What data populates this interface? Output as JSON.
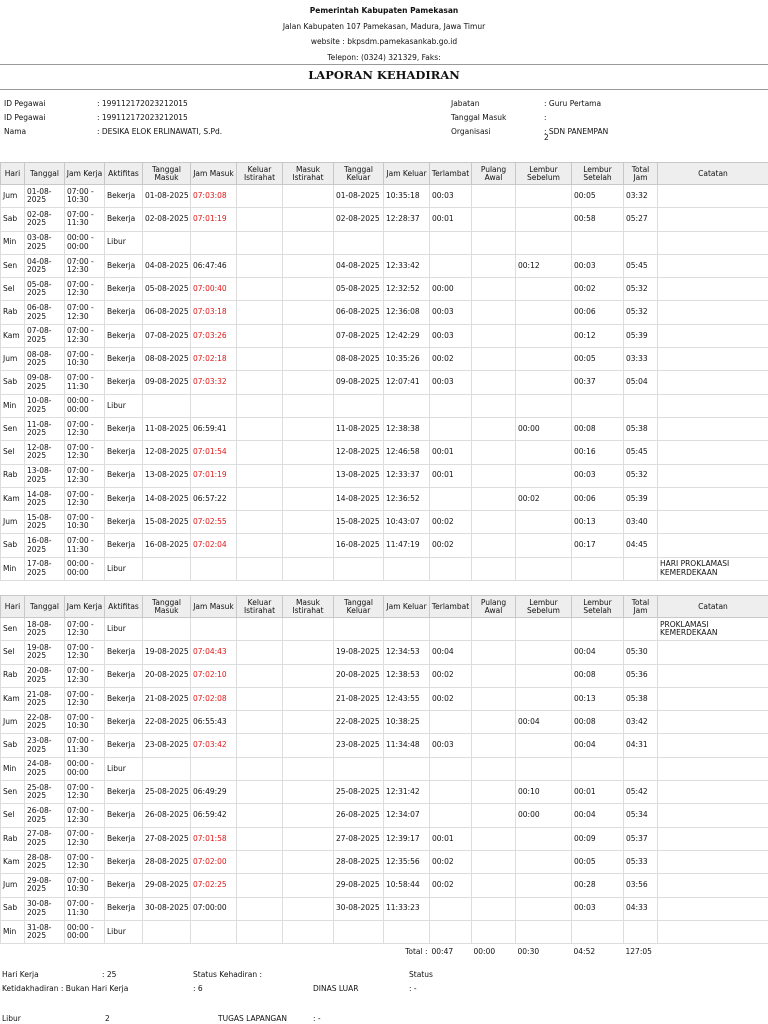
{
  "header": {
    "agency": "Pemerintah Kabupaten Pamekasan",
    "address": "Jalan Kabupaten 107 Pamekasan, Madura, Jawa Timur",
    "website": "website : bkpsdm.pamekasankab.go.id",
    "phone": "Telepon: (0324) 321329, Faks:"
  },
  "title": "LAPORAN KEHADIRAN",
  "employee": {
    "left": [
      {
        "label": "ID Pegawai",
        "value": ": 199112172023212015"
      },
      {
        "label": "ID Pegawai",
        "value": ": 199112172023212015"
      },
      {
        "label": "Nama",
        "value": ": DESIKA ELOK ERLINAWATI, S.Pd."
      }
    ],
    "right": [
      {
        "label": "Jabatan",
        "value": ": Guru Pertama"
      },
      {
        "label": "Tanggal Masuk",
        "value": ":"
      },
      {
        "label": "Organisasi",
        "value": ": SDN PANEMPAN",
        "value2": "2"
      }
    ]
  },
  "columns": [
    "Hari",
    "Tanggal",
    "Jam Kerja",
    "Aktifitas",
    "Tanggal Masuk",
    "Jam Masuk",
    "Keluar Istirahat",
    "Masuk Istirahat",
    "Tanggal Keluar",
    "Jam Keluar",
    "Terlambat",
    "Pulang Awal",
    "Lembur Sebelum",
    "Lembur Setelah",
    "Total Jam",
    "Catatan"
  ],
  "late_color": "#e01818",
  "table1": [
    {
      "hari": "Jum",
      "tgl": "01-08-2025",
      "jk": "07:00 - 10:30",
      "akt": "Bekerja",
      "tm": "01-08-2025",
      "jm": "07:03:08",
      "late": true,
      "tk": "01-08-2025",
      "jkel": "10:35:18",
      "tl": "00:03",
      "pa": "",
      "ls": "",
      "lst": "00:05",
      "tj": "03:32",
      "cat": ""
    },
    {
      "hari": "Sab",
      "tgl": "02-08-2025",
      "jk": "07:00 - 11:30",
      "akt": "Bekerja",
      "tm": "02-08-2025",
      "jm": "07:01:19",
      "late": true,
      "tk": "02-08-2025",
      "jkel": "12:28:37",
      "tl": "00:01",
      "pa": "",
      "ls": "",
      "lst": "00:58",
      "tj": "05:27",
      "cat": ""
    },
    {
      "hari": "Min",
      "tgl": "03-08-2025",
      "jk": "00:00 - 00:00",
      "akt": "Libur",
      "tm": "",
      "jm": "",
      "late": false,
      "tk": "",
      "jkel": "",
      "tl": "",
      "pa": "",
      "ls": "",
      "lst": "",
      "tj": "",
      "cat": ""
    },
    {
      "hari": "Sen",
      "tgl": "04-08-2025",
      "jk": "07:00 - 12:30",
      "akt": "Bekerja",
      "tm": "04-08-2025",
      "jm": "06:47:46",
      "late": false,
      "tk": "04-08-2025",
      "jkel": "12:33:42",
      "tl": "",
      "pa": "",
      "ls": "00:12",
      "lst": "00:03",
      "tj": "05:45",
      "cat": ""
    },
    {
      "hari": "Sel",
      "tgl": "05-08-2025",
      "jk": "07:00 - 12:30",
      "akt": "Bekerja",
      "tm": "05-08-2025",
      "jm": "07:00:40",
      "late": true,
      "tk": "05-08-2025",
      "jkel": "12:32:52",
      "tl": "00:00",
      "pa": "",
      "ls": "",
      "lst": "00:02",
      "tj": "05:32",
      "cat": ""
    },
    {
      "hari": "Rab",
      "tgl": "06-08-2025",
      "jk": "07:00 - 12:30",
      "akt": "Bekerja",
      "tm": "06-08-2025",
      "jm": "07:03:18",
      "late": true,
      "tk": "06-08-2025",
      "jkel": "12:36:08",
      "tl": "00:03",
      "pa": "",
      "ls": "",
      "lst": "00:06",
      "tj": "05:32",
      "cat": ""
    },
    {
      "hari": "Kam",
      "tgl": "07-08-2025",
      "jk": "07:00 - 12:30",
      "akt": "Bekerja",
      "tm": "07-08-2025",
      "jm": "07:03:26",
      "late": true,
      "tk": "07-08-2025",
      "jkel": "12:42:29",
      "tl": "00:03",
      "pa": "",
      "ls": "",
      "lst": "00:12",
      "tj": "05:39",
      "cat": ""
    },
    {
      "hari": "Jum",
      "tgl": "08-08-2025",
      "jk": "07:00 - 10:30",
      "akt": "Bekerja",
      "tm": "08-08-2025",
      "jm": "07:02:18",
      "late": true,
      "tk": "08-08-2025",
      "jkel": "10:35:26",
      "tl": "00:02",
      "pa": "",
      "ls": "",
      "lst": "00:05",
      "tj": "03:33",
      "cat": ""
    },
    {
      "hari": "Sab",
      "tgl": "09-08-2025",
      "jk": "07:00 - 11:30",
      "akt": "Bekerja",
      "tm": "09-08-2025",
      "jm": "07:03:32",
      "late": true,
      "tk": "09-08-2025",
      "jkel": "12:07:41",
      "tl": "00:03",
      "pa": "",
      "ls": "",
      "lst": "00:37",
      "tj": "05:04",
      "cat": ""
    },
    {
      "hari": "Min",
      "tgl": "10-08-2025",
      "jk": "00:00 - 00:00",
      "akt": "Libur",
      "tm": "",
      "jm": "",
      "late": false,
      "tk": "",
      "jkel": "",
      "tl": "",
      "pa": "",
      "ls": "",
      "lst": "",
      "tj": "",
      "cat": ""
    },
    {
      "hari": "Sen",
      "tgl": "11-08-2025",
      "jk": "07:00 - 12:30",
      "akt": "Bekerja",
      "tm": "11-08-2025",
      "jm": "06:59:41",
      "late": false,
      "tk": "11-08-2025",
      "jkel": "12:38:38",
      "tl": "",
      "pa": "",
      "ls": "00:00",
      "lst": "00:08",
      "tj": "05:38",
      "cat": ""
    },
    {
      "hari": "Sel",
      "tgl": "12-08-2025",
      "jk": "07:00 - 12:30",
      "akt": "Bekerja",
      "tm": "12-08-2025",
      "jm": "07:01:54",
      "late": true,
      "tk": "12-08-2025",
      "jkel": "12:46:58",
      "tl": "00:01",
      "pa": "",
      "ls": "",
      "lst": "00:16",
      "tj": "05:45",
      "cat": ""
    },
    {
      "hari": "Rab",
      "tgl": "13-08-2025",
      "jk": "07:00 - 12:30",
      "akt": "Bekerja",
      "tm": "13-08-2025",
      "jm": "07:01:19",
      "late": true,
      "tk": "13-08-2025",
      "jkel": "12:33:37",
      "tl": "00:01",
      "pa": "",
      "ls": "",
      "lst": "00:03",
      "tj": "05:32",
      "cat": ""
    },
    {
      "hari": "Kam",
      "tgl": "14-08-2025",
      "jk": "07:00 - 12:30",
      "akt": "Bekerja",
      "tm": "14-08-2025",
      "jm": "06:57:22",
      "late": false,
      "tk": "14-08-2025",
      "jkel": "12:36:52",
      "tl": "",
      "pa": "",
      "ls": "00:02",
      "lst": "00:06",
      "tj": "05:39",
      "cat": ""
    },
    {
      "hari": "Jum",
      "tgl": "15-08-2025",
      "jk": "07:00 - 10:30",
      "akt": "Bekerja",
      "tm": "15-08-2025",
      "jm": "07:02:55",
      "late": true,
      "tk": "15-08-2025",
      "jkel": "10:43:07",
      "tl": "00:02",
      "pa": "",
      "ls": "",
      "lst": "00:13",
      "tj": "03:40",
      "cat": ""
    },
    {
      "hari": "Sab",
      "tgl": "16-08-2025",
      "jk": "07:00 - 11:30",
      "akt": "Bekerja",
      "tm": "16-08-2025",
      "jm": "07:02:04",
      "late": true,
      "tk": "16-08-2025",
      "jkel": "11:47:19",
      "tl": "00:02",
      "pa": "",
      "ls": "",
      "lst": "00:17",
      "tj": "04:45",
      "cat": ""
    },
    {
      "hari": "Min",
      "tgl": "17-08-2025",
      "jk": "00:00 - 00:00",
      "akt": "Libur",
      "tm": "",
      "jm": "",
      "late": false,
      "tk": "",
      "jkel": "",
      "tl": "",
      "pa": "",
      "ls": "",
      "lst": "",
      "tj": "",
      "cat": "HARI PROKLAMASI KEMERDEKAAN"
    }
  ],
  "table2": [
    {
      "hari": "Sen",
      "tgl": "18-08-2025",
      "jk": "07:00 - 12:30",
      "akt": "Libur",
      "tm": "",
      "jm": "",
      "late": false,
      "tk": "",
      "jkel": "",
      "tl": "",
      "pa": "",
      "ls": "",
      "lst": "",
      "tj": "",
      "cat": "PROKLAMASI KEMERDEKAAN"
    },
    {
      "hari": "Sel",
      "tgl": "19-08-2025",
      "jk": "07:00 - 12:30",
      "akt": "Bekerja",
      "tm": "19-08-2025",
      "jm": "07:04:43",
      "late": true,
      "tk": "19-08-2025",
      "jkel": "12:34:53",
      "tl": "00:04",
      "pa": "",
      "ls": "",
      "lst": "00:04",
      "tj": "05:30",
      "cat": ""
    },
    {
      "hari": "Rab",
      "tgl": "20-08-2025",
      "jk": "07:00 - 12:30",
      "akt": "Bekerja",
      "tm": "20-08-2025",
      "jm": "07:02:10",
      "late": true,
      "tk": "20-08-2025",
      "jkel": "12:38:53",
      "tl": "00:02",
      "pa": "",
      "ls": "",
      "lst": "00:08",
      "tj": "05:36",
      "cat": ""
    },
    {
      "hari": "Kam",
      "tgl": "21-08-2025",
      "jk": "07:00 - 12:30",
      "akt": "Bekerja",
      "tm": "21-08-2025",
      "jm": "07:02:08",
      "late": true,
      "tk": "21-08-2025",
      "jkel": "12:43:55",
      "tl": "00:02",
      "pa": "",
      "ls": "",
      "lst": "00:13",
      "tj": "05:38",
      "cat": ""
    },
    {
      "hari": "Jum",
      "tgl": "22-08-2025",
      "jk": "07:00 - 10:30",
      "akt": "Bekerja",
      "tm": "22-08-2025",
      "jm": "06:55:43",
      "late": false,
      "tk": "22-08-2025",
      "jkel": "10:38:25",
      "tl": "",
      "pa": "",
      "ls": "00:04",
      "lst": "00:08",
      "tj": "03:42",
      "cat": ""
    },
    {
      "hari": "Sab",
      "tgl": "23-08-2025",
      "jk": "07:00 - 11:30",
      "akt": "Bekerja",
      "tm": "23-08-2025",
      "jm": "07:03:42",
      "late": true,
      "tk": "23-08-2025",
      "jkel": "11:34:48",
      "tl": "00:03",
      "pa": "",
      "ls": "",
      "lst": "00:04",
      "tj": "04:31",
      "cat": ""
    },
    {
      "hari": "Min",
      "tgl": "24-08-2025",
      "jk": "00:00 - 00:00",
      "akt": "Libur",
      "tm": "",
      "jm": "",
      "late": false,
      "tk": "",
      "jkel": "",
      "tl": "",
      "pa": "",
      "ls": "",
      "lst": "",
      "tj": "",
      "cat": ""
    },
    {
      "hari": "Sen",
      "tgl": "25-08-2025",
      "jk": "07:00 - 12:30",
      "akt": "Bekerja",
      "tm": "25-08-2025",
      "jm": "06:49:29",
      "late": false,
      "tk": "25-08-2025",
      "jkel": "12:31:42",
      "tl": "",
      "pa": "",
      "ls": "00:10",
      "lst": "00:01",
      "tj": "05:42",
      "cat": ""
    },
    {
      "hari": "Sel",
      "tgl": "26-08-2025",
      "jk": "07:00 - 12:30",
      "akt": "Bekerja",
      "tm": "26-08-2025",
      "jm": "06:59:42",
      "late": false,
      "tk": "26-08-2025",
      "jkel": "12:34:07",
      "tl": "",
      "pa": "",
      "ls": "00:00",
      "lst": "00:04",
      "tj": "05:34",
      "cat": ""
    },
    {
      "hari": "Rab",
      "tgl": "27-08-2025",
      "jk": "07:00 - 12:30",
      "akt": "Bekerja",
      "tm": "27-08-2025",
      "jm": "07:01:58",
      "late": true,
      "tk": "27-08-2025",
      "jkel": "12:39:17",
      "tl": "00:01",
      "pa": "",
      "ls": "",
      "lst": "00:09",
      "tj": "05:37",
      "cat": ""
    },
    {
      "hari": "Kam",
      "tgl": "28-08-2025",
      "jk": "07:00 - 12:30",
      "akt": "Bekerja",
      "tm": "28-08-2025",
      "jm": "07:02:00",
      "late": true,
      "tk": "28-08-2025",
      "jkel": "12:35:56",
      "tl": "00:02",
      "pa": "",
      "ls": "",
      "lst": "00:05",
      "tj": "05:33",
      "cat": ""
    },
    {
      "hari": "Jum",
      "tgl": "29-08-2025",
      "jk": "07:00 - 10:30",
      "akt": "Bekerja",
      "tm": "29-08-2025",
      "jm": "07:02:25",
      "late": true,
      "tk": "29-08-2025",
      "jkel": "10:58:44",
      "tl": "00:02",
      "pa": "",
      "ls": "",
      "lst": "00:28",
      "tj": "03:56",
      "cat": ""
    },
    {
      "hari": "Sab",
      "tgl": "30-08-2025",
      "jk": "07:00 - 11:30",
      "akt": "Bekerja",
      "tm": "30-08-2025",
      "jm": "07:00:00",
      "late": false,
      "tk": "30-08-2025",
      "jkel": "11:33:23",
      "tl": "",
      "pa": "",
      "ls": "",
      "lst": "00:03",
      "tj": "04:33",
      "cat": ""
    },
    {
      "hari": "Min",
      "tgl": "31-08-2025",
      "jk": "00:00 - 00:00",
      "akt": "Libur",
      "tm": "",
      "jm": "",
      "late": false,
      "tk": "",
      "jkel": "",
      "tl": "",
      "pa": "",
      "ls": "",
      "lst": "",
      "tj": "",
      "cat": ""
    }
  ],
  "totals": {
    "label": "Total :",
    "terlambat": "00:47",
    "pulang_awal": "00:00",
    "lembur_sebelum": "00:30",
    "lembur_setelah": "04:52",
    "total_jam": "127:05"
  },
  "summary": {
    "hari_kerja_label": "Hari Kerja",
    "hari_kerja_value": ": 25",
    "status_kehadiran_label": "Status Kehadiran :",
    "status_label": "Status",
    "ketidakhadiran_label": "Ketidakhadiran : Bukan Hari Kerja",
    "ketidakhadiran_value": ": 6",
    "dinas_luar_label": "DINAS LUAR",
    "dinas_luar_value": ": -",
    "libur_label": "Libur",
    "libur_value": "2",
    "tugas_lapangan_label": "TUGAS LAPANGAN",
    "tugas_lapangan_value": ": -"
  }
}
